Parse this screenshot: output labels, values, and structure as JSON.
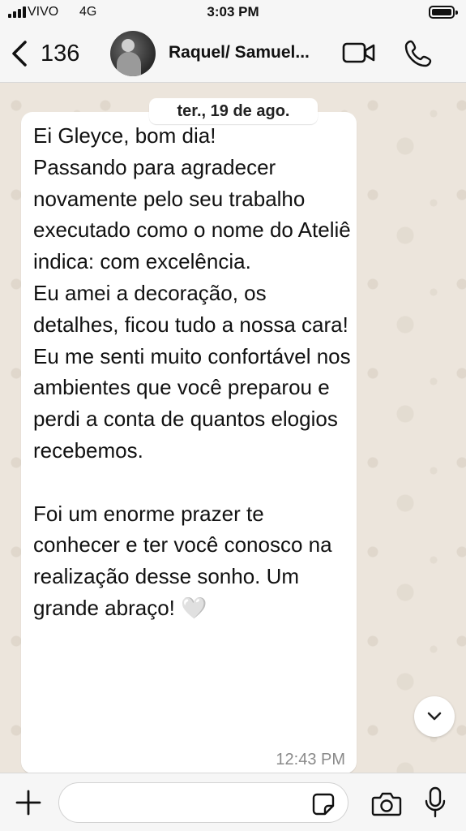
{
  "status_bar": {
    "carrier": "VIVO",
    "network": "4G",
    "time": "3:03 PM",
    "icons": [
      "signal-icon",
      "battery-icon"
    ]
  },
  "header": {
    "back_count": "136",
    "contact_name": "Raquel/ Samuel...",
    "icons": [
      "chevron-left-icon",
      "video-call-icon",
      "phone-call-icon"
    ]
  },
  "date_separator": "ter., 19 de ago.",
  "message": {
    "text": "Ei Gleyce, bom dia!\nPassando para agradecer novamente pelo seu trabalho executado como o nome do Ateliê indica: com excelência.\nEu amei a decoração, os detalhes, ficou tudo a nossa cara! Eu me senti muito confortável nos ambientes que você preparou e perdi a conta de quantos elogios recebemos.\n\nFoi um enorme prazer te conhecer e ter você conosco na realização desse sonho. Um grande abraço! 🤍",
    "time": "12:43 PM"
  },
  "composer": {
    "input_value": "",
    "icons": [
      "plus-icon",
      "sticker-icon",
      "camera-icon",
      "microphone-icon"
    ]
  },
  "colors": {
    "wallpaper": "#ece5dc",
    "bar_background": "#f6f6f6",
    "bubble": "#ffffff",
    "timestamp": "#8a8a8a"
  }
}
